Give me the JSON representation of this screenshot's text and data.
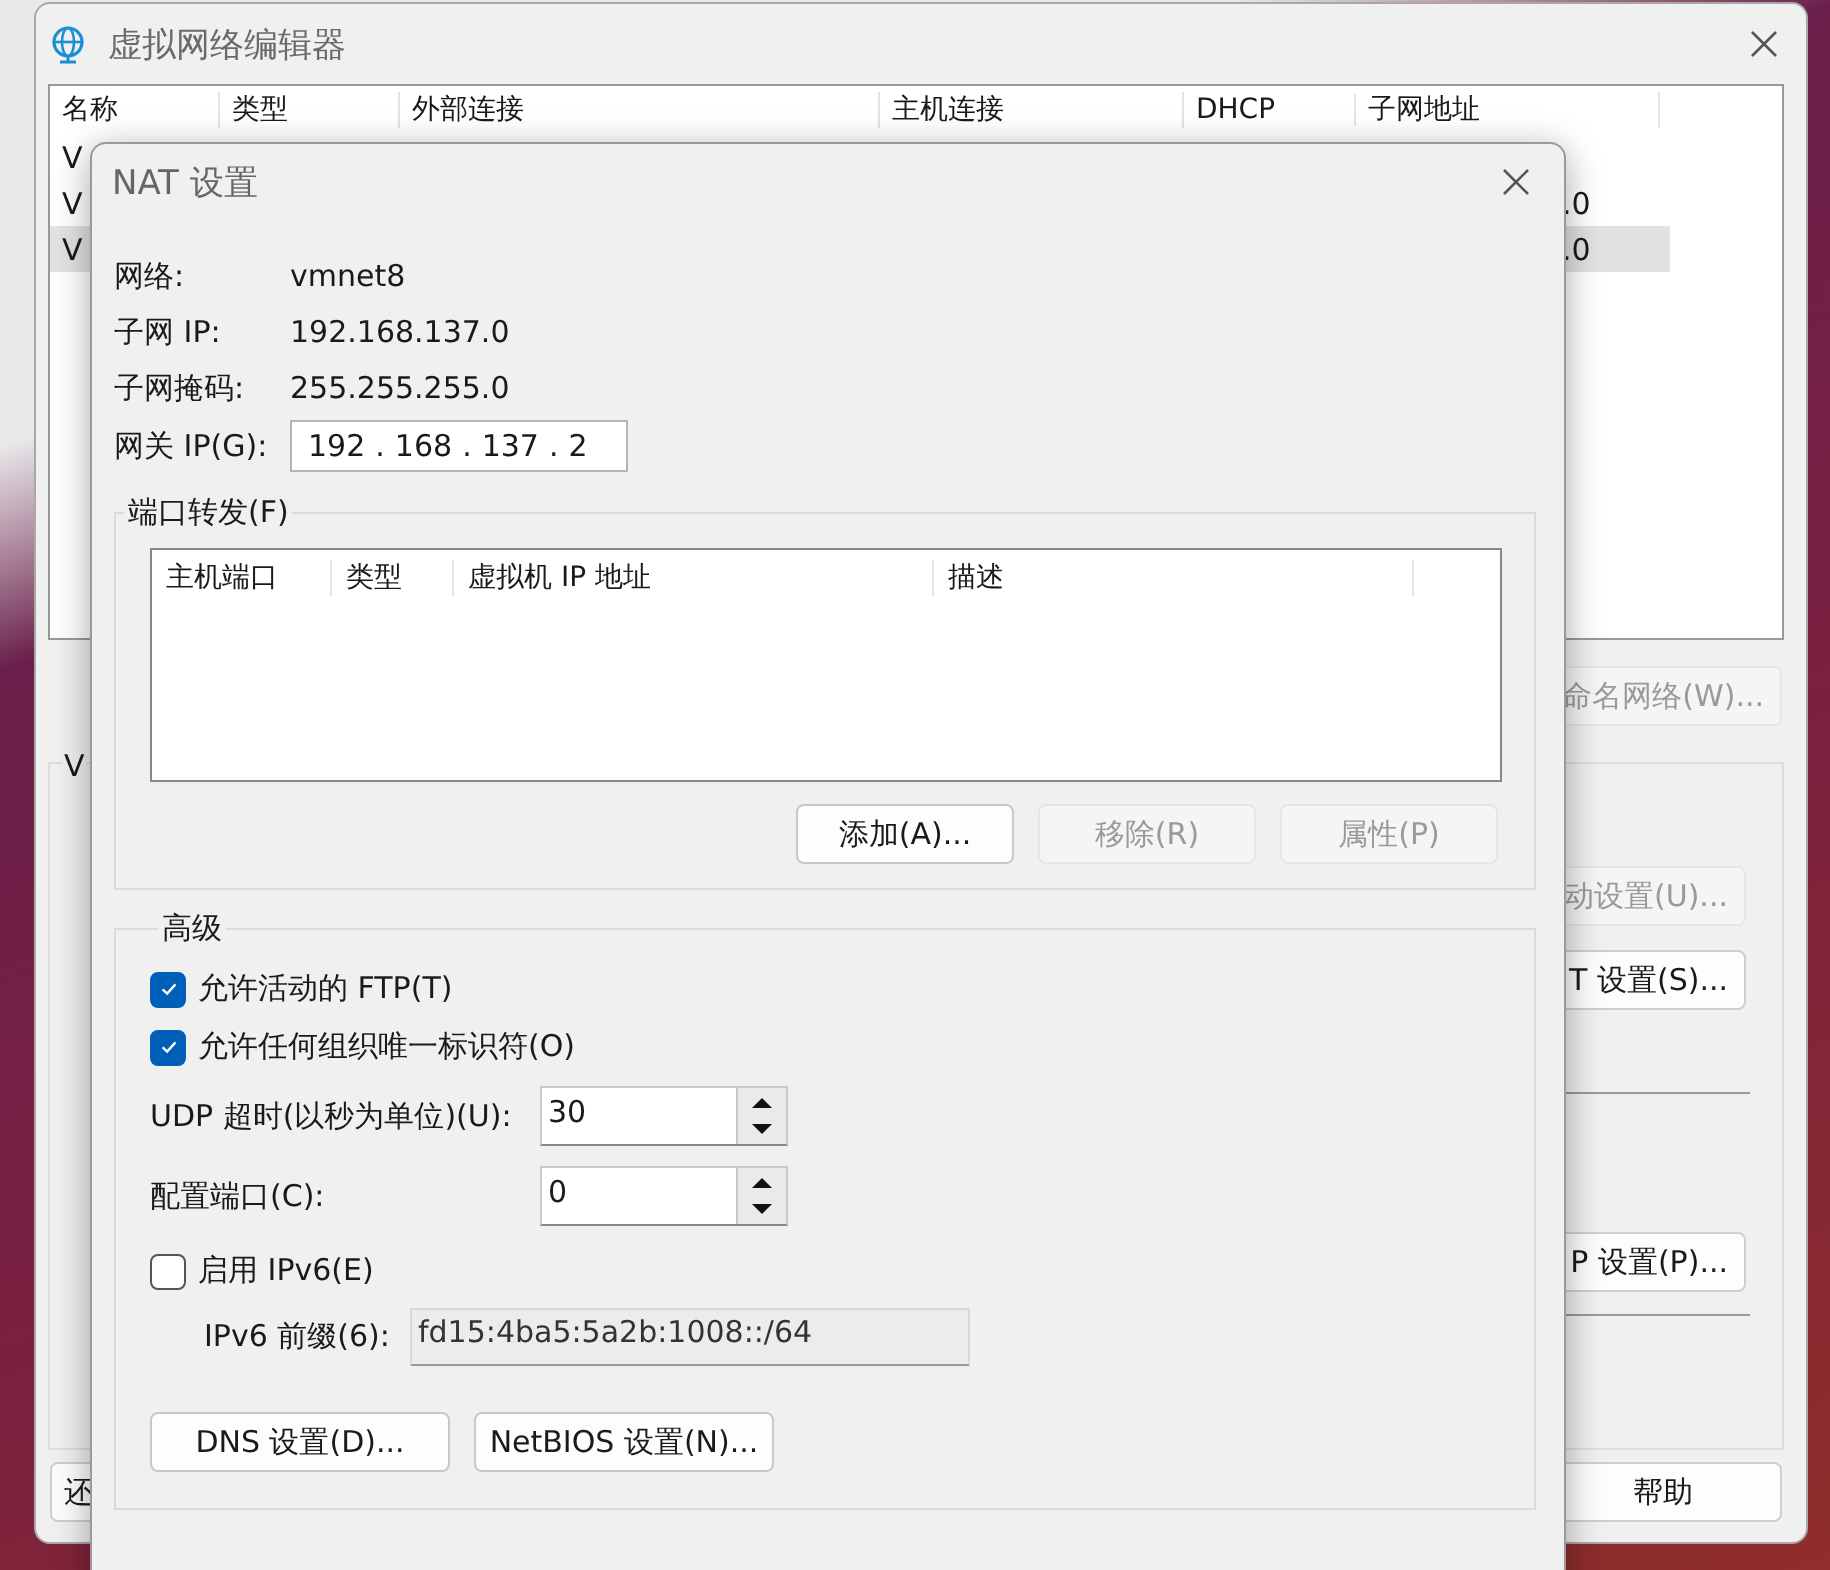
{
  "main_window": {
    "title": "虚拟网络编辑器",
    "table": {
      "columns": [
        "名称",
        "类型",
        "外部连接",
        "主机连接",
        "DHCP",
        "子网地址"
      ],
      "rows": [
        {
          "name": "V",
          "selected": false
        },
        {
          "name": "V",
          "subnet": ".0",
          "selected": false
        },
        {
          "name": "V",
          "subnet": ".0",
          "selected": true
        }
      ]
    },
    "group_title": "V",
    "buttons": [
      {
        "kind": "rename",
        "label": "命名网络(W)...",
        "disabled": true
      },
      {
        "kind": "auto",
        "label": "动设置(U)...",
        "disabled": true
      },
      {
        "kind": "nat",
        "label": "T 设置(S)...",
        "disabled": false
      },
      {
        "kind": "dhcp",
        "label": "P 设置(P)...",
        "disabled": false
      },
      {
        "kind": "restore",
        "label": "还",
        "disabled": false
      },
      {
        "kind": "help",
        "label": "帮助",
        "disabled": false
      }
    ]
  },
  "nat_dialog": {
    "title": "NAT 设置",
    "info": [
      {
        "label": "网络:",
        "value": "vmnet8"
      },
      {
        "label": "子网 IP:",
        "value": "192.168.137.0"
      },
      {
        "label": "子网掩码:",
        "value": "255.255.255.0"
      }
    ],
    "gateway": {
      "label": "网关 IP(G):",
      "octets": [
        "192",
        "168",
        "137",
        "2"
      ],
      "separator": "."
    },
    "port_forwarding": {
      "title": "端口转发(F)",
      "columns": [
        "主机端口",
        "类型",
        "虚拟机 IP 地址",
        "描述"
      ],
      "buttons": [
        {
          "label": "添加(A)...",
          "disabled": false
        },
        {
          "label": "移除(R)",
          "disabled": true
        },
        {
          "label": "属性(P)",
          "disabled": true
        }
      ]
    },
    "advanced": {
      "title": "高级",
      "checkboxes": [
        {
          "label": "允许活动的 FTP(T)",
          "checked": true
        },
        {
          "label": "允许任何组织唯一标识符(O)",
          "checked": true
        }
      ],
      "spinners": [
        {
          "label": "UDP 超时(以秒为单位)(U):",
          "value": "30"
        },
        {
          "label": "配置端口(C):",
          "value": "0"
        }
      ],
      "ipv6": {
        "label": "启用 IPv6(E)",
        "checked": false
      },
      "prefix": {
        "label": "IPv6 前缀(6):",
        "value": "fd15:4ba5:5a2b:1008::/64",
        "disabled": true
      },
      "buttons": [
        {
          "label": "DNS 设置(D)..."
        },
        {
          "label": "NetBIOS 设置(N)..."
        }
      ]
    }
  }
}
